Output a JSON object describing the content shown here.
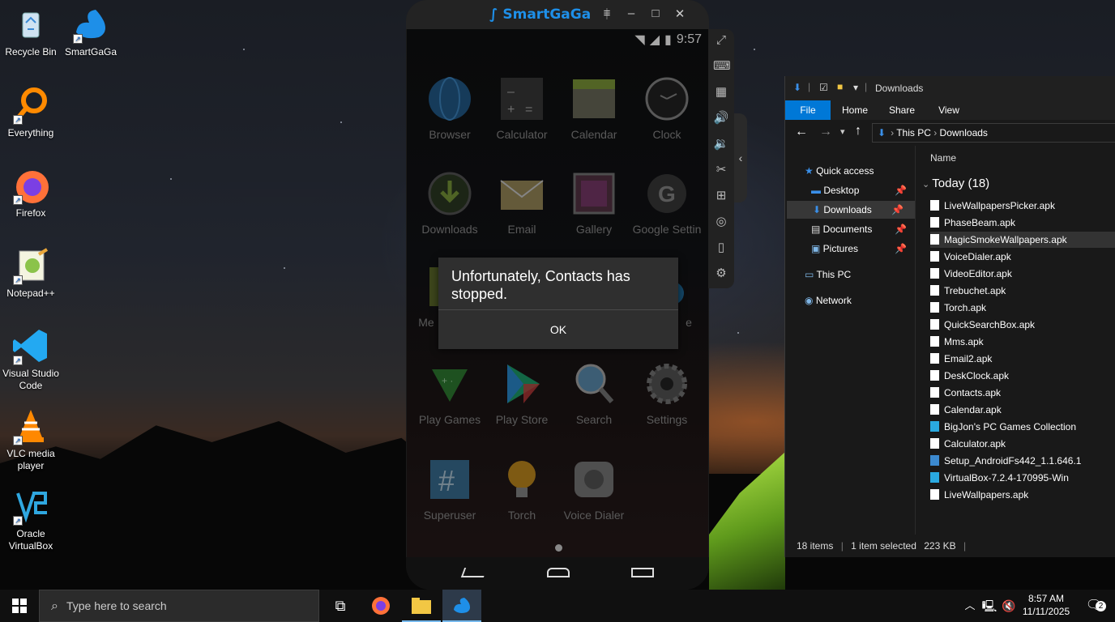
{
  "desktop": {
    "icons": [
      {
        "label": "Recycle Bin",
        "icon": "recycle-bin-icon"
      },
      {
        "label": "SmartGaGa",
        "icon": "smartgaga-icon"
      },
      {
        "label": "Everything",
        "icon": "everything-icon"
      },
      {
        "label": "Firefox",
        "icon": "firefox-icon"
      },
      {
        "label": "Notepad++",
        "icon": "notepadpp-icon"
      },
      {
        "label": "Visual Studio Code",
        "icon": "vscode-icon"
      },
      {
        "label": "VLC media player",
        "icon": "vlc-icon"
      },
      {
        "label": "Oracle VirtualBox",
        "icon": "virtualbox-icon"
      }
    ]
  },
  "emulator": {
    "title": "SmartGaGa",
    "status_time": "9:57",
    "apps": [
      {
        "label": "Browser"
      },
      {
        "label": "Calculator"
      },
      {
        "label": "Calendar"
      },
      {
        "label": "Clock"
      },
      {
        "label": "Downloads"
      },
      {
        "label": "Email"
      },
      {
        "label": "Gallery"
      },
      {
        "label": "Google Settin"
      },
      {
        "label": "Me"
      },
      {
        "label": "e"
      },
      {
        "label": "Play Games"
      },
      {
        "label": "Play Store"
      },
      {
        "label": "Search"
      },
      {
        "label": "Settings"
      },
      {
        "label": "Superuser"
      },
      {
        "label": "Torch"
      },
      {
        "label": "Voice Dialer"
      }
    ],
    "dialog": {
      "message": "Unfortunately, Contacts has stopped.",
      "button": "OK"
    }
  },
  "explorer": {
    "title": "Downloads",
    "tabs": [
      "File",
      "Home",
      "Share",
      "View"
    ],
    "breadcrumb": [
      "This PC",
      "Downloads"
    ],
    "nav": [
      {
        "label": "Quick access"
      },
      {
        "label": "Desktop"
      },
      {
        "label": "Downloads"
      },
      {
        "label": "Documents"
      },
      {
        "label": "Pictures"
      },
      {
        "label": "This PC"
      },
      {
        "label": "Network"
      }
    ],
    "column": "Name",
    "group": "Today (18)",
    "files": [
      "LiveWallpapersPicker.apk",
      "PhaseBeam.apk",
      "MagicSmokeWallpapers.apk",
      "VoiceDialer.apk",
      "VideoEditor.apk",
      "Trebuchet.apk",
      "Torch.apk",
      "QuickSearchBox.apk",
      "Mms.apk",
      "Email2.apk",
      "DeskClock.apk",
      "Contacts.apk",
      "Calendar.apk",
      "BigJon's PC Games Collection",
      "Calculator.apk",
      "Setup_AndroidFs442_1.1.646.1",
      "VirtualBox-7.2.4-170995-Win",
      "LiveWallpapers.apk"
    ],
    "status": {
      "items": "18 items",
      "selected": "1 item selected",
      "size": "223 KB"
    }
  },
  "taskbar": {
    "search_placeholder": "Type here to search",
    "time": "8:57 AM",
    "date": "11/11/2025",
    "notifications": "2"
  },
  "colors": {
    "accent": "#0078d7",
    "brand": "#1e8fe8"
  }
}
